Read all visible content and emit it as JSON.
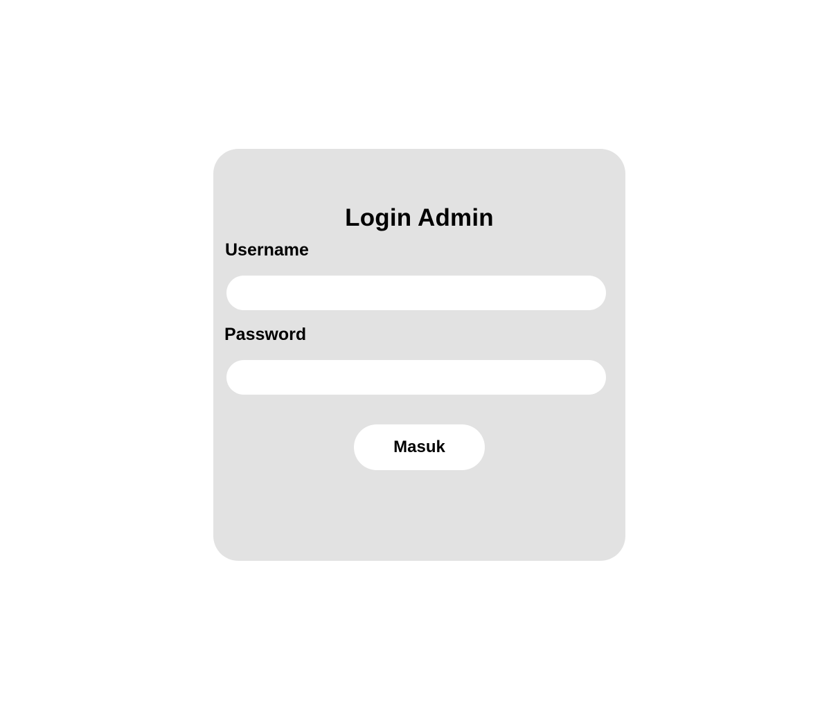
{
  "login": {
    "title": "Login Admin",
    "username_label": "Username",
    "username_value": "",
    "password_label": "Password",
    "password_value": "",
    "submit_label": "Masuk"
  },
  "colors": {
    "page_background": "#ffffff",
    "card_background": "#e2e2e2",
    "input_background": "#ffffff",
    "button_background": "#ffffff",
    "text": "#000000"
  }
}
